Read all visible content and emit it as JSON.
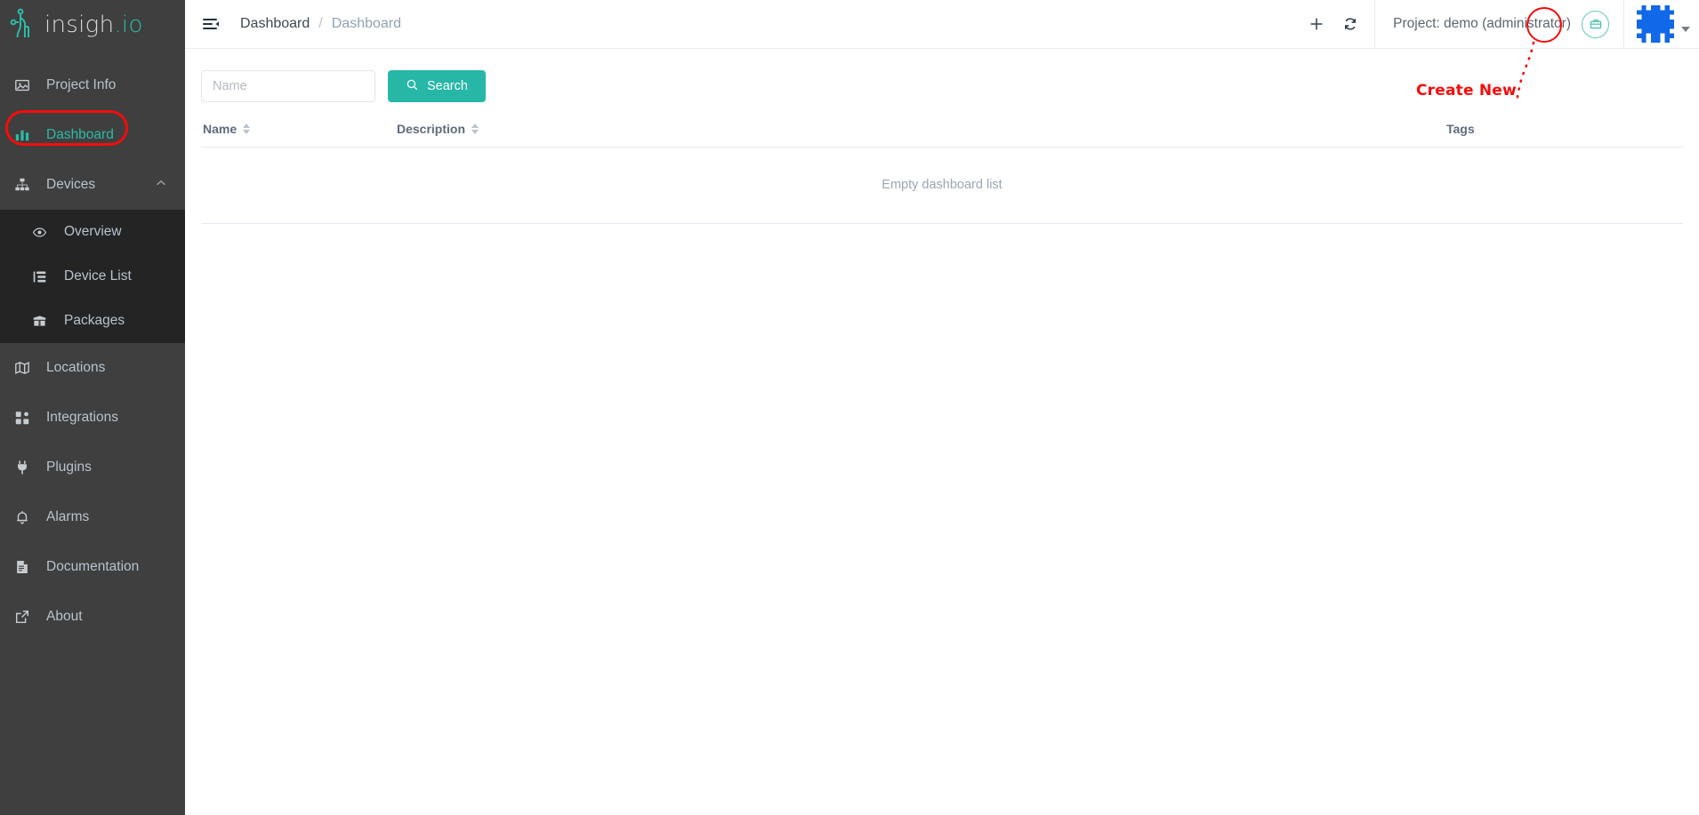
{
  "brand": {
    "name": "insigh",
    "suffix": ".io",
    "logo_icon": "insighio-circuit-logo",
    "accent_color": "#2bbba6"
  },
  "sidebar": {
    "items": [
      {
        "label": "Project Info",
        "icon": "image-icon",
        "active": false
      },
      {
        "label": "Dashboard",
        "icon": "bar-chart-icon",
        "active": true
      },
      {
        "label": "Devices",
        "icon": "sitemap-icon",
        "active": false,
        "expanded": true,
        "chevron": "chevron-up-icon"
      },
      {
        "label": "Locations",
        "icon": "map-icon",
        "active": false
      },
      {
        "label": "Integrations",
        "icon": "grid-icon",
        "active": false
      },
      {
        "label": "Plugins",
        "icon": "plug-icon",
        "active": false
      },
      {
        "label": "Alarms",
        "icon": "bell-icon",
        "active": false
      },
      {
        "label": "Documentation",
        "icon": "document-icon",
        "active": false
      },
      {
        "label": "About",
        "icon": "external-link-icon",
        "active": false
      }
    ],
    "devices_submenu": [
      {
        "label": "Overview",
        "icon": "eye-icon"
      },
      {
        "label": "Device List",
        "icon": "list-tree-icon"
      },
      {
        "label": "Packages",
        "icon": "box-icon"
      }
    ]
  },
  "topbar": {
    "menu_toggle_icon": "hamburger-collapse-icon",
    "breadcrumb": {
      "root": "Dashboard",
      "separator": "/",
      "current": "Dashboard"
    },
    "create_new_icon": "plus-icon",
    "refresh_icon": "refresh-icon",
    "project_label": "Project: demo (administrator)",
    "project_icon": "briefcase-icon",
    "avatar_icon": "identicon-avatar",
    "avatar_caret_icon": "caret-down-icon"
  },
  "annotations": {
    "create_new_label": "Create New",
    "color": "#f40c0c"
  },
  "content": {
    "search": {
      "placeholder": "Name",
      "value": "",
      "button_label": "Search",
      "button_icon": "search-icon"
    },
    "table": {
      "columns": [
        {
          "label": "Name",
          "sortable": true
        },
        {
          "label": "Description",
          "sortable": true
        },
        {
          "label": "Tags",
          "sortable": false
        }
      ],
      "rows": [],
      "empty_message": "Empty dashboard list"
    }
  }
}
